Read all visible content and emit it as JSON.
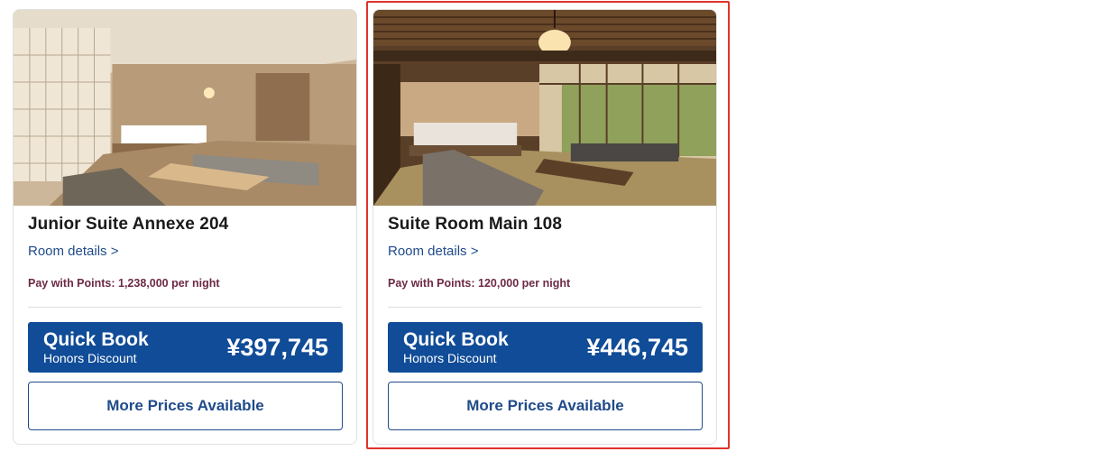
{
  "rooms": [
    {
      "title": "Junior Suite Annexe 204",
      "details_link": "Room details >",
      "points_text": "Pay with Points: 1,238,000 per night",
      "quickbook_title": "Quick Book",
      "quickbook_sub": "Honors Discount",
      "price": "¥397,745",
      "more_prices": "More Prices Available"
    },
    {
      "title": "Suite Room Main 108",
      "details_link": "Room details >",
      "points_text": "Pay with Points: 120,000 per night",
      "quickbook_title": "Quick Book",
      "quickbook_sub": "Honors Discount",
      "price": "¥446,745",
      "more_prices": "More Prices Available"
    }
  ],
  "colors": {
    "brand_blue": "#104c97",
    "link_blue": "#1f4b8a",
    "points_text": "#6d2a45",
    "highlight": "#e0332b"
  }
}
